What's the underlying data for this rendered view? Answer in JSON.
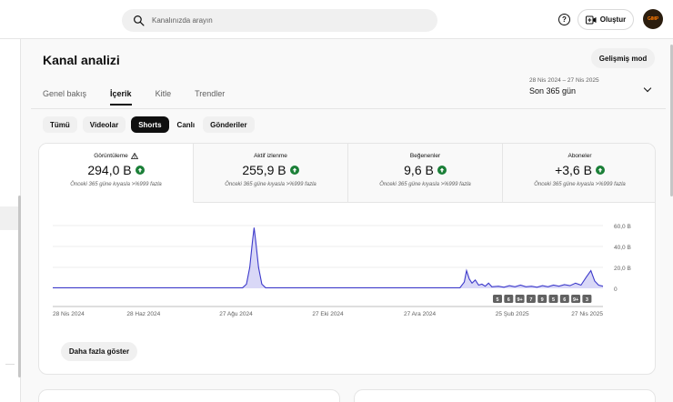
{
  "header": {
    "search_placeholder": "Kanalınızda arayın",
    "create_label": "Oluştur",
    "help_label": "?",
    "avatar_text": "GIMP"
  },
  "page": {
    "title": "Kanal analizi",
    "advanced_button": "Gelişmiş mod",
    "tabs": [
      {
        "label": "Genel bakış",
        "active": false
      },
      {
        "label": "İçerik",
        "active": true
      },
      {
        "label": "Kitle",
        "active": false
      },
      {
        "label": "Trendler",
        "active": false
      }
    ],
    "date_range": "28 Nis 2024 – 27 Nis 2025",
    "date_period": "Son 365 gün"
  },
  "chips": [
    {
      "label": "Tümü",
      "selected": false
    },
    {
      "label": "Videolar",
      "selected": false
    },
    {
      "label": "Shorts",
      "selected": true
    },
    {
      "label": "Canlı",
      "selected": false
    },
    {
      "label": "Gönderiler",
      "selected": false
    }
  ],
  "metrics": [
    {
      "label": "Görüntüleme",
      "value": "294,0 B",
      "sub": "Önceki 365 güne kıyasla >%999 fazla",
      "warning": true
    },
    {
      "label": "Aktif izlenme",
      "value": "255,9 B",
      "sub": "Önceki 365 güne kıyasla >%999 fazla",
      "warning": false
    },
    {
      "label": "Beğenenler",
      "value": "9,6 B",
      "sub": "Önceki 365 güne kıyasla >%999 fazla",
      "warning": false
    },
    {
      "label": "Aboneler",
      "value": "+3,6 B",
      "sub": "Önceki 365 güne kıyasla >%999 fazla",
      "warning": false
    }
  ],
  "more_button": "Daha fazla göster",
  "colors": {
    "line": "#3d3acb",
    "fill": "#c9c8f3",
    "positive": "#1a7f37"
  },
  "chart_data": {
    "type": "area",
    "x_ticks": [
      "28 Nis 2024",
      "28 Haz 2024",
      "27 Ağu 2024",
      "27 Eki 2024",
      "27 Ara 2024",
      "25 Şub 2025",
      "27 Nis 2025"
    ],
    "y_ticks": [
      "60,0 B",
      "40,0 B",
      "20,0 B",
      "0"
    ],
    "ylim": [
      0,
      60
    ],
    "points": [
      [
        0,
        0.5
      ],
      [
        0.33,
        0.5
      ],
      [
        0.345,
        0.5
      ],
      [
        0.352,
        4
      ],
      [
        0.358,
        20
      ],
      [
        0.363,
        45
      ],
      [
        0.366,
        58
      ],
      [
        0.369,
        45
      ],
      [
        0.374,
        20
      ],
      [
        0.38,
        4
      ],
      [
        0.387,
        0.5
      ],
      [
        0.55,
        0.5
      ],
      [
        0.7,
        0.5
      ],
      [
        0.74,
        0.5
      ],
      [
        0.748,
        6
      ],
      [
        0.752,
        17
      ],
      [
        0.757,
        9
      ],
      [
        0.762,
        5
      ],
      [
        0.768,
        8
      ],
      [
        0.774,
        3
      ],
      [
        0.78,
        4
      ],
      [
        0.786,
        2
      ],
      [
        0.792,
        5
      ],
      [
        0.798,
        1.5
      ],
      [
        0.81,
        2
      ],
      [
        0.82,
        1
      ],
      [
        0.83,
        2.5
      ],
      [
        0.84,
        1.5
      ],
      [
        0.85,
        3
      ],
      [
        0.86,
        1.5
      ],
      [
        0.87,
        2
      ],
      [
        0.88,
        1
      ],
      [
        0.89,
        2.5
      ],
      [
        0.9,
        1.5
      ],
      [
        0.91,
        3
      ],
      [
        0.92,
        2
      ],
      [
        0.93,
        3.5
      ],
      [
        0.94,
        2.5
      ],
      [
        0.95,
        5
      ],
      [
        0.96,
        3
      ],
      [
        0.97,
        11
      ],
      [
        0.978,
        17
      ],
      [
        0.985,
        7
      ],
      [
        0.992,
        3
      ],
      [
        1.0,
        2
      ]
    ],
    "markers": [
      "5",
      "6",
      "9+",
      "7",
      "9",
      "5",
      "6",
      "9+",
      "3"
    ]
  }
}
